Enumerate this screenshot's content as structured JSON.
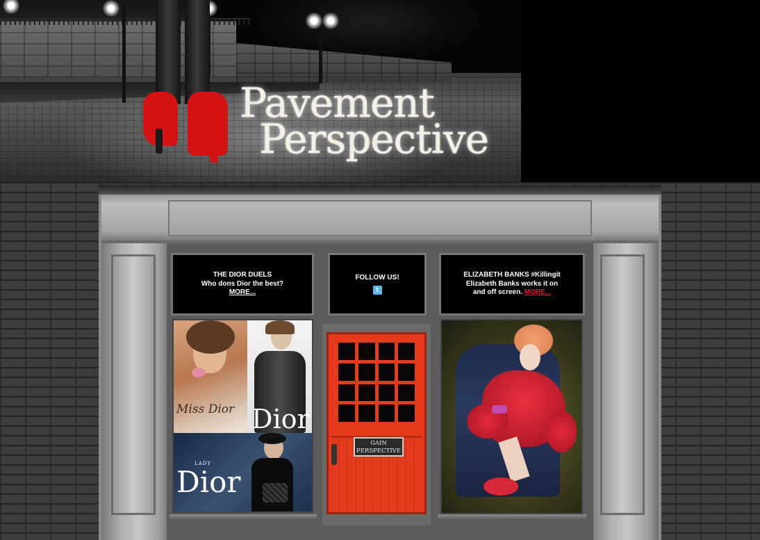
{
  "site": {
    "logo_line1": "Pavement",
    "logo_line2": "Perspective"
  },
  "signs": {
    "left": {
      "title": "THE DIOR DUELS",
      "text": "Who dons Dior the best?",
      "more": "MORE..."
    },
    "center": {
      "title": "FOLLOW US!",
      "icon": "twitter-icon"
    },
    "right": {
      "title": "ELIZABETH BANKS #Killingit",
      "text_line1": "Elizabeth Banks works it on",
      "text_line2": "and off screen.",
      "more": "MORE..."
    }
  },
  "window_left": {
    "tile1_script": "Miss Dior",
    "tile2_word": "Dior",
    "tile3_small": "LADY",
    "tile3_word": "Dior"
  },
  "door": {
    "sign_line1": "GAIN",
    "sign_line2": "PERSPECTIVE"
  },
  "colors": {
    "accent_red": "#e8192c",
    "door_red": "#e63a1c",
    "twitter_blue": "#5fb8ea"
  }
}
